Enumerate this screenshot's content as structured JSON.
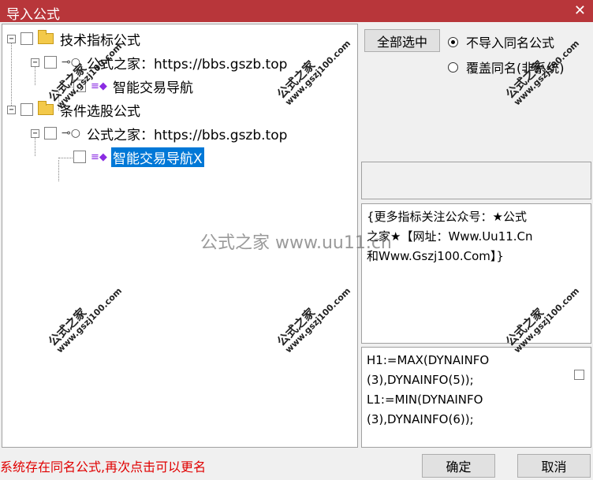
{
  "window": {
    "title": "导入公式",
    "close_glyph": "✕"
  },
  "tree": {
    "groups": [
      {
        "label": "技术指标公式",
        "expander": "−",
        "source": {
          "label": "公式之家：https://bbs.gszb.top",
          "expander": "−",
          "item": {
            "label": "智能交易导航",
            "selected": false
          }
        }
      },
      {
        "label": "条件选股公式",
        "expander": "−",
        "source": {
          "label": "公式之家：https://bbs.gszb.top",
          "expander": "−",
          "item": {
            "label": "智能交易导航X",
            "selected": true
          }
        }
      }
    ],
    "icons": {
      "group": "folder-icon",
      "source": "key-icon",
      "item": "gem-icon"
    }
  },
  "options": {
    "select_all_label": "全部选中",
    "radio_no_import": {
      "label": "不导入同名公式",
      "checked": true
    },
    "radio_overwrite": {
      "label": "覆盖同名(非系统)",
      "checked": false
    }
  },
  "description": {
    "line1": "{更多指标关注公众号：★公式",
    "line2": "之家★【网址：Www.Uu11.Cn",
    "line3": "和Www.Gszj100.Com】}"
  },
  "code": {
    "line1": "H1:=MAX(DYNAINFO",
    "line2": "(3),DYNAINFO(5));",
    "line3": "L1:=MIN(DYNAINFO",
    "line4": "(3),DYNAINFO(6));"
  },
  "status_text": "系统存在同名公式,再次点击可以更名",
  "buttons": {
    "ok_label": "确定",
    "cancel_label": "取消"
  },
  "watermarks": {
    "center_text": "公式之家 www.uu11.cn",
    "stamp_title": "公式之家",
    "stamp_url": "www.gszj100.com"
  },
  "colors": {
    "titlebar": "#b8363a",
    "selection": "#0078d7",
    "status_text": "#e00000"
  }
}
